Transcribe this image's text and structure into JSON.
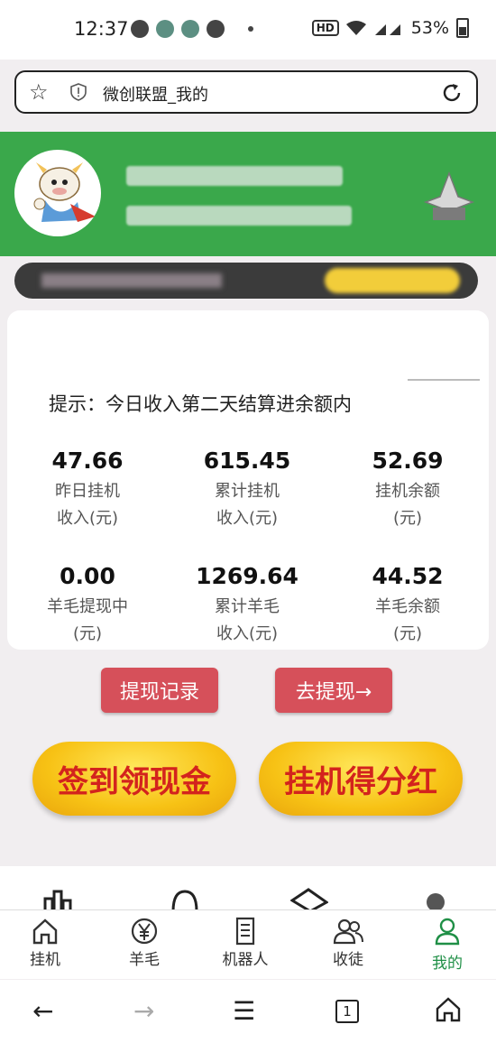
{
  "status_bar": {
    "time": "12:37",
    "battery": "53%",
    "hd": "HD"
  },
  "address_bar": {
    "url_text": "微创联盟_我的"
  },
  "notice": {
    "text": "提示：今日收入第二天结算进余额内"
  },
  "stats": [
    {
      "value": "47.66",
      "label": "昨日挂机\n收入(元)"
    },
    {
      "value": "615.45",
      "label": "累计挂机\n收入(元)"
    },
    {
      "value": "52.69",
      "label": "挂机余额\n(元)"
    },
    {
      "value": "0.00",
      "label": "羊毛提现中\n(元)"
    },
    {
      "value": "1269.64",
      "label": "累计羊毛\n收入(元)"
    },
    {
      "value": "44.52",
      "label": "羊毛余额\n(元)"
    }
  ],
  "buttons": {
    "withdraw_record": "提现记录",
    "go_withdraw": "去提现→",
    "checkin": "签到领现金",
    "dividend": "挂机得分红"
  },
  "tabs": [
    {
      "label": "挂机",
      "icon": "home-icon"
    },
    {
      "label": "羊毛",
      "icon": "yen-icon"
    },
    {
      "label": "机器人",
      "icon": "document-icon"
    },
    {
      "label": "收徒",
      "icon": "users-icon"
    },
    {
      "label": "我的",
      "icon": "user-icon",
      "active": true
    }
  ],
  "system_nav": {
    "tab_count": "1"
  },
  "colors": {
    "header_green": "#3aa84b",
    "button_red": "#d6505a",
    "gold": "#f7c215",
    "active_tab": "#1f8f46"
  }
}
